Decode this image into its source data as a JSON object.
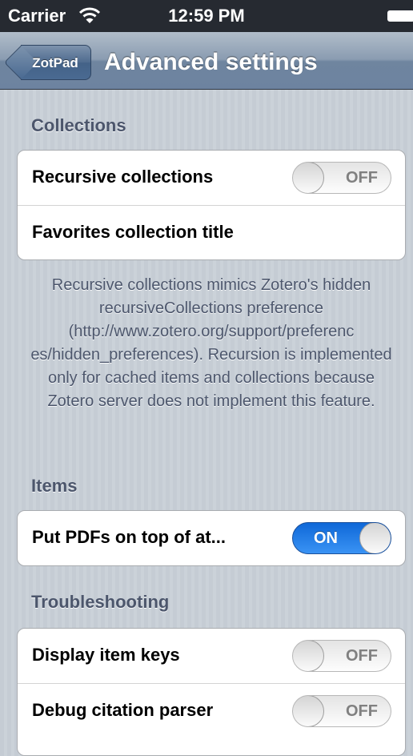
{
  "status_bar": {
    "carrier": "Carrier",
    "time": "12:59 PM"
  },
  "nav": {
    "back_label": "ZotPad",
    "title": "Advanced settings"
  },
  "sections": {
    "collections": {
      "header": "Collections",
      "rows": [
        {
          "label": "Recursive collections",
          "switch": "OFF"
        },
        {
          "label": "Favorites collection title"
        }
      ],
      "footer": "Recursive collections mimics Zotero's hidden recursiveCollections preference (http://www.zotero.org/support/preferenc es/hidden_preferences). Recursion is implemented only for cached items and collections because Zotero server does not implement this feature."
    },
    "items": {
      "header": "Items",
      "rows": [
        {
          "label": "Put PDFs on top of at...",
          "switch": "ON"
        }
      ]
    },
    "troubleshooting": {
      "header": "Troubleshooting",
      "rows": [
        {
          "label": "Display item keys",
          "switch": "OFF"
        },
        {
          "label": "Debug citation parser",
          "switch": "OFF"
        }
      ]
    }
  },
  "colors": {
    "accent_on": "#1f73e0",
    "section_text": "#4c566c",
    "nav_bar": "#6f859f"
  },
  "icons": {
    "wifi": "wifi-icon",
    "battery": "battery-icon",
    "back": "back-arrow-icon"
  }
}
